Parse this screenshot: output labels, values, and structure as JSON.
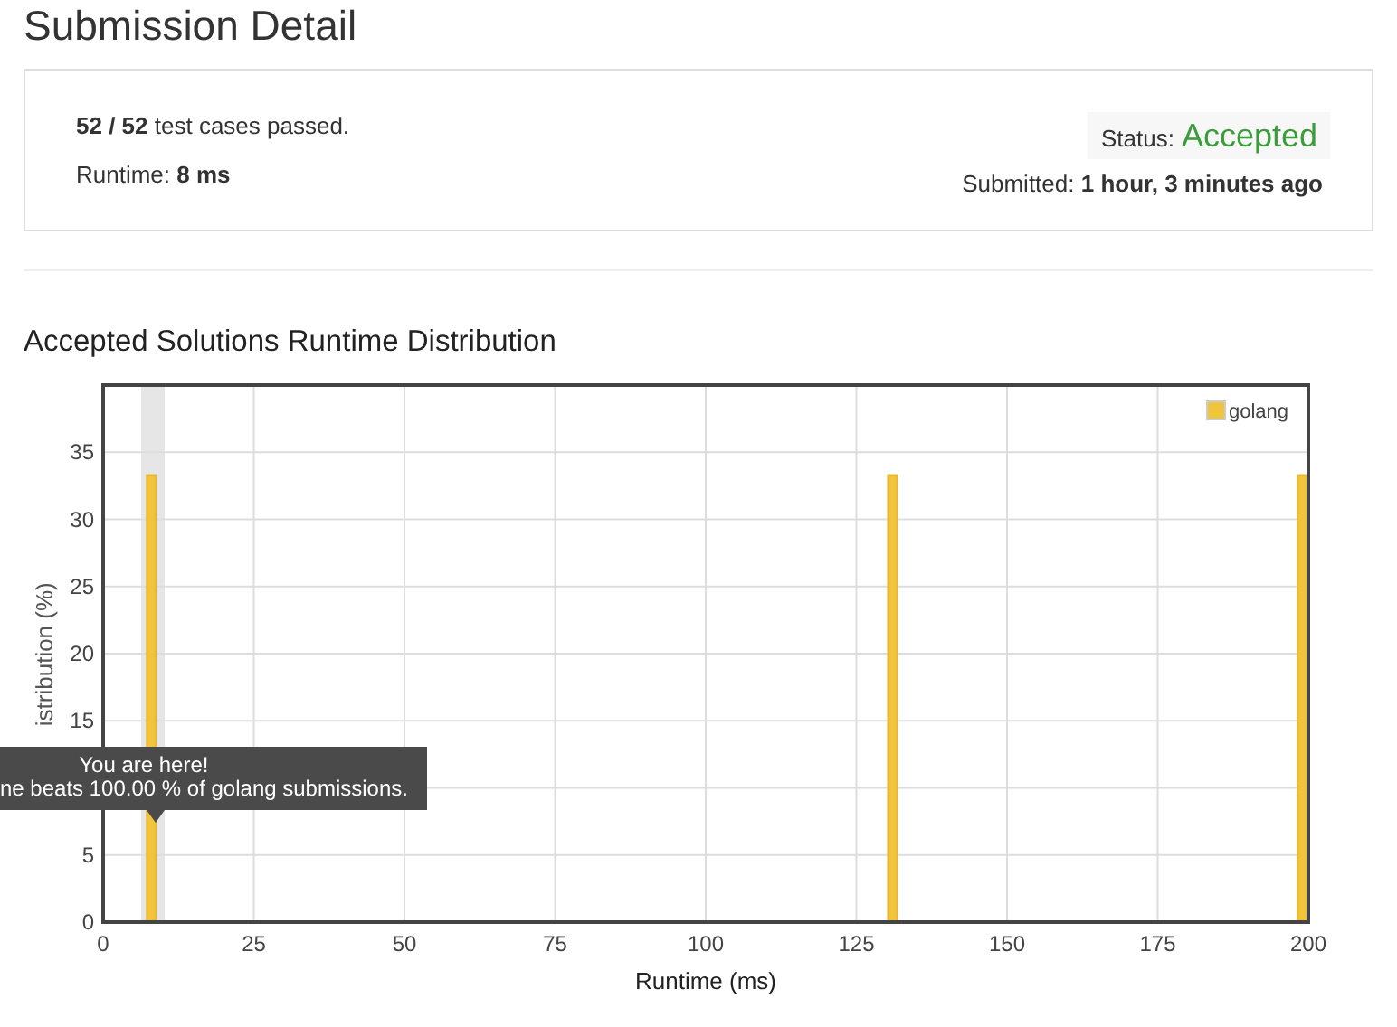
{
  "page_title": "Submission Detail",
  "summary": {
    "passed": "**52 / 52** test cases passed.",
    "status_label": "Status:",
    "status_value": "Accepted",
    "runtime": "Runtime: **8 ms**",
    "submitted": "Submitted: **1 hour, 3 minutes ago**"
  },
  "chart": {
    "title": "Accepted Solutions Runtime Distribution",
    "chart_data": {
      "type": "bar",
      "xlabel": "Runtime (ms)",
      "ylabel": "istribution (%)",
      "x": [
        8,
        131,
        199
      ],
      "series": [
        {
          "name": "golang",
          "color": "#f0c43c",
          "values": [
            33.3,
            33.3,
            33.3
          ]
        }
      ],
      "xlim": [
        0,
        200
      ],
      "ylim": [
        0,
        40
      ],
      "xticks": [
        0,
        25,
        50,
        75,
        100,
        125,
        150,
        175,
        200
      ],
      "yticks": [
        0,
        5,
        15,
        20,
        25,
        30,
        35
      ],
      "grid": true,
      "data_labels": false
    },
    "tooltip": {
      "title": "You are here!",
      "text": "ne beats 100.00 % of golang submissions."
    }
  }
}
